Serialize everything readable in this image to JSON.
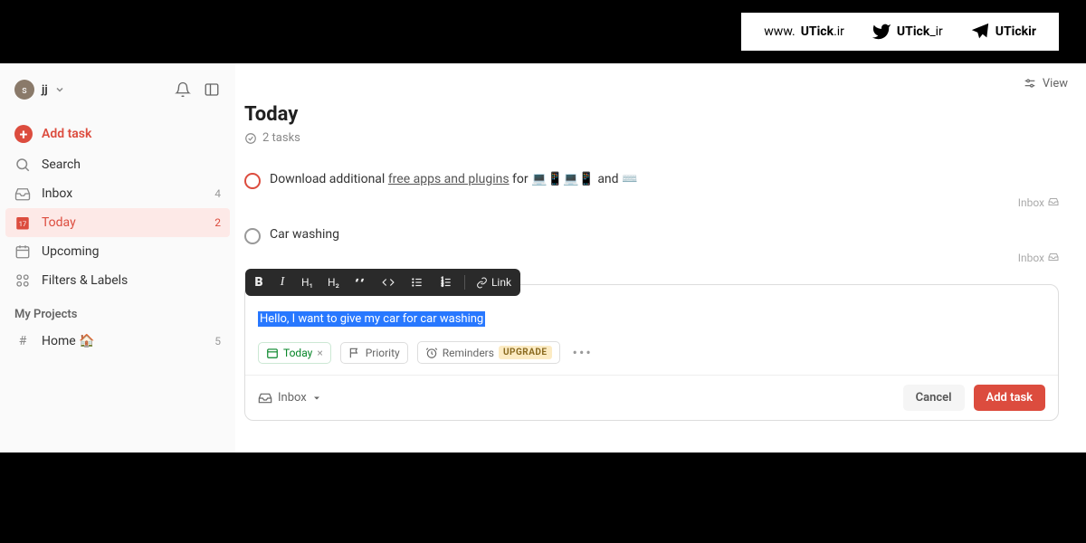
{
  "banner": {
    "website": "www.UTick.ir",
    "twitter": "UTick_ir",
    "telegram": "UTickir"
  },
  "user": {
    "initial": "s",
    "name": "jj"
  },
  "sidebar": {
    "add_task": "Add task",
    "items": [
      {
        "icon": "search",
        "label": "Search",
        "count": ""
      },
      {
        "icon": "inbox",
        "label": "Inbox",
        "count": "4"
      },
      {
        "icon": "today",
        "label": "Today",
        "count": "2",
        "active": true
      },
      {
        "icon": "upcoming",
        "label": "Upcoming",
        "count": ""
      },
      {
        "icon": "filters",
        "label": "Filters & Labels",
        "count": ""
      }
    ],
    "projects_header": "My Projects",
    "projects": [
      {
        "label": "Home 🏠",
        "count": "5"
      }
    ]
  },
  "header": {
    "view": "View"
  },
  "page": {
    "title": "Today",
    "subtitle": "2 tasks"
  },
  "tasks": [
    {
      "title_pre": "Download additional ",
      "title_link": "free apps and plugins",
      "title_post": " for 💻📱💻📱 and ⌨️",
      "project": "Inbox",
      "priority": "p1"
    },
    {
      "title_pre": "Car washing",
      "title_link": "",
      "title_post": "",
      "project": "Inbox",
      "priority": ""
    }
  ],
  "toolbar": {
    "bold": "B",
    "italic": "I",
    "h1": "H₁",
    "h2": "H₂",
    "quote": "❝",
    "code": "</>",
    "ul": "≔",
    "ol": "≕",
    "link": "Link"
  },
  "editor": {
    "text": "Hello, I want to give my car for car washing",
    "chips": {
      "today": "Today",
      "priority": "Priority",
      "reminders": "Reminders",
      "upgrade": "UPGRADE"
    },
    "project": "Inbox",
    "cancel": "Cancel",
    "submit": "Add task"
  }
}
